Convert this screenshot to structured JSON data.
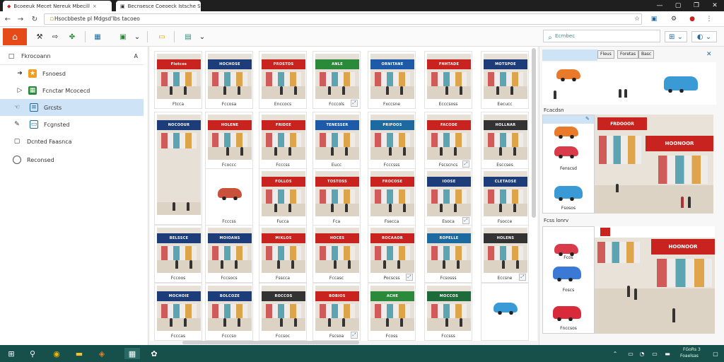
{
  "browser": {
    "tabs": [
      {
        "title": "Bcoeeuk Mecet Nereuk Mbecill",
        "close": "×"
      },
      {
        "title": "Becnsesce Coeoeck Istsche Sete",
        "close": "×"
      }
    ],
    "window_controls": {
      "minimize": "—",
      "maximize": "▢",
      "close": "✕"
    },
    "url": "Hsocbbeste pl Mdgsd'lbs tacoeo"
  },
  "toolbar": {
    "search_placeholder": "Ecrnbec"
  },
  "sidebar": {
    "header": {
      "label": "Fkrocoann",
      "caret": "A"
    },
    "items": [
      {
        "label": "Fsnoesd"
      },
      {
        "label": "Fcnctar Mcocecd"
      },
      {
        "label": "Grcsts"
      },
      {
        "label": "Fcgnsted"
      },
      {
        "label": "Dcnted Faasnca"
      },
      {
        "label": "Reconsed"
      }
    ],
    "selected_index": 2
  },
  "grid": {
    "thumbs": [
      {
        "sign": "Flotcos",
        "cap": "Ftcca",
        "color": "#c8231f"
      },
      {
        "sign": "HOCHOSE",
        "cap": "Fccosa",
        "color": "#1d3d7a"
      },
      {
        "sign": "PROSTOS",
        "cap": "Enccocs",
        "color": "#c8231f"
      },
      {
        "sign": "ANLE",
        "cap": "Fcccols",
        "color": "#2a8a3a"
      },
      {
        "sign": "ORNITANE",
        "cap": "Fxccsne",
        "color": "#1d5aa8"
      },
      {
        "sign": "FNHTADE",
        "cap": "Ecccsoss",
        "color": "#c8231f"
      },
      {
        "sign": "MOTSPOE",
        "cap": "Eecucc",
        "color": "#1d3d7a"
      },
      {
        "sign": "NOCOOUR",
        "cap": "",
        "color": "#1d3d7a"
      },
      {
        "sign": "HOLENE",
        "cap": "Fcoccc",
        "color": "#c8231f"
      },
      {
        "sign": "FRIDEE",
        "cap": "Fcccss",
        "color": "#c8231f"
      },
      {
        "sign": "TENESSER",
        "cap": "Eucc",
        "color": "#1d5aa8"
      },
      {
        "sign": "PRIPOOS",
        "cap": "Fcccsss",
        "color": "#1d6aa0"
      },
      {
        "sign": "FACODE",
        "cap": "Fscscncs",
        "color": "#c8231f"
      },
      {
        "sign": "HOLLNAR",
        "cap": "Esccses",
        "color": "#333"
      },
      {
        "sign": "",
        "cap": "Fcccss",
        "color": "#eee"
      },
      {
        "sign": "FOLLOS",
        "cap": "Fucca",
        "color": "#c8231f"
      },
      {
        "sign": "TOSTOSS",
        "cap": "Fca",
        "color": "#c8231f"
      },
      {
        "sign": "FROCOSE",
        "cap": "Fsecca",
        "color": "#c8231f"
      },
      {
        "sign": "IOOSE",
        "cap": "Esoca",
        "color": "#1d3d7a"
      },
      {
        "sign": "CLETAOSE",
        "cap": "Fsocce",
        "color": "#1d3d7a"
      },
      {
        "sign": "BELSSCE",
        "cap": "Fccoos",
        "color": "#1d3d7a"
      },
      {
        "sign": "MOIOANS",
        "cap": "Fccsocs",
        "color": "#1d3d7a"
      },
      {
        "sign": "MIKLOS",
        "cap": "Fsscca",
        "color": "#c8231f"
      },
      {
        "sign": "HOCES",
        "cap": "Fccasc",
        "color": "#c8231f"
      },
      {
        "sign": "ROCAAOR",
        "cap": "Pocscss",
        "color": "#c8231f"
      },
      {
        "sign": "ROPELLE",
        "cap": "Fcsosss",
        "color": "#1d6aa0"
      },
      {
        "sign": "HOLENS",
        "cap": "Eccsne",
        "color": "#333"
      },
      {
        "sign": "MOCHOIE",
        "cap": "Fcccas",
        "color": "#1d3d7a"
      },
      {
        "sign": "BOLCOZE",
        "cap": "Fcccso",
        "color": "#1d3d7a"
      },
      {
        "sign": "ROCCOS",
        "cap": "Fccsoc",
        "color": "#333"
      },
      {
        "sign": "BOBIOS",
        "cap": "Fscsoa",
        "color": "#c8231f"
      },
      {
        "sign": "ACHE",
        "cap": "Fcoss",
        "color": "#2a8a3a"
      },
      {
        "sign": "MOCCOS",
        "cap": "Fccsss",
        "color": "#1d6a3a"
      },
      {
        "sign": "",
        "cap": "",
        "color": "#eee"
      }
    ]
  },
  "preview": {
    "tabs": [
      "Fleus",
      "Foretas",
      "Basc"
    ],
    "close": "✕",
    "section1_label": "Fcacdsn",
    "section2_label": "Fcss lonrv",
    "list1_caps": [
      "",
      "Fenscsd",
      "Fsosos"
    ],
    "list2_caps": [
      "Fcos",
      "Foscs",
      "Fnccsos"
    ],
    "big_sign": "FRDOOOR",
    "big_sign2": "HOONOOR"
  },
  "taskbar": {
    "tray_top": "FGoRs 3",
    "tray_bottom": "Foaelsas"
  }
}
